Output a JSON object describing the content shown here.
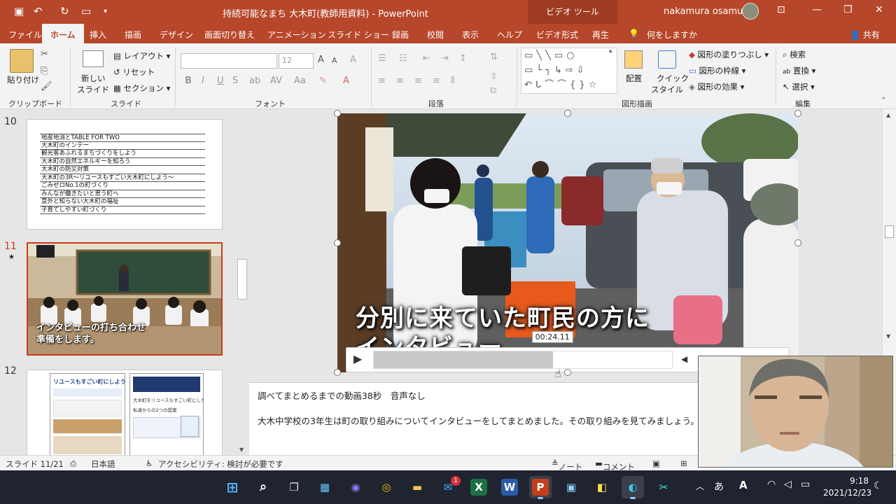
{
  "titlebar": {
    "document_title": "持続可能なまち 大木町(教師用資料) - PowerPoint",
    "context_tab": "ビデオ ツール",
    "user": "nakamura osamu"
  },
  "tabs": [
    "ファイル",
    "ホーム",
    "挿入",
    "描画",
    "デザイン",
    "画面切り替え",
    "アニメーション",
    "スライド ショー",
    "録画",
    "校閲",
    "表示",
    "ヘルプ",
    "ビデオ形式",
    "再生"
  ],
  "tell_me": "何をしますか",
  "share": "共有",
  "ribbon": {
    "clipboard": {
      "paste": "貼り付け",
      "label": "クリップボード"
    },
    "slides": {
      "new_slide": "新しい",
      "new_slide2": "スライド",
      "layout": "レイアウト",
      "reset": "リセット",
      "section": "セクション",
      "label": "スライド"
    },
    "font": {
      "size": "12",
      "label": "フォント",
      "bold": "B",
      "italic": "I",
      "underline": "U",
      "strike": "S"
    },
    "paragraph": {
      "label": "段落"
    },
    "drawing": {
      "arrange": "配置",
      "quick_style": "クイック",
      "quick_style2": "スタイル",
      "fill": "図形の塗りつぶし",
      "outline": "図形の枠線",
      "effects": "図形の効果",
      "label": "図形描画"
    },
    "editing": {
      "find": "検索",
      "replace": "置換",
      "select": "選択",
      "label": "編集"
    }
  },
  "slides": {
    "items": [
      {
        "number": "10",
        "rows": [
          "地産地消とTABLE FOR TWO",
          "大木町のインテー",
          "観光客あふれるまちづくりをしよう",
          "大木町の自然エネルギーを知ろう",
          "大木町の防災対策",
          "大木町の3R〜リユースもすごい大木町にしよう〜",
          "ごみゼロNo.1の町づくり",
          "みんなが働きたいと思う町へ",
          "意外と知らない大木町の福祉",
          "子育てしやすい町づくり"
        ]
      },
      {
        "number": "11",
        "star": "★",
        "caption_line1": "インタビューの打ち合わせ",
        "caption_line2": "準備をします。"
      },
      {
        "number": "12",
        "left_title": "リユースもすごい町にしよう",
        "right_title": "大木町をリユースもすごい町にしたい!",
        "right_sub": "私達からの2つの提案"
      }
    ]
  },
  "video": {
    "subtitle_line1": "分別に来ていた町民の方に",
    "subtitle_line2": "インタビュー",
    "timestamp": "00:24.11",
    "progress": 0.6
  },
  "notes": {
    "line1": "調べてまとめるまでの動画38秒　音声なし",
    "line2": "大木中学校の3年生は町の取り組みについてインタビューをしてまとめました。その取り組みを見てみましょう。"
  },
  "statusbar": {
    "slide": "スライド 11/21",
    "language": "日本語",
    "accessibility": "アクセシビリティ: 検討が必要です",
    "notes": "ノート",
    "comments": "コメント"
  },
  "taskbar": {
    "mail_badge": "1",
    "ime": "あ",
    "time": "9:18",
    "date": "2021/12/23"
  },
  "colors": {
    "accent": "#b7472a",
    "taskbar": "#1f2430"
  }
}
